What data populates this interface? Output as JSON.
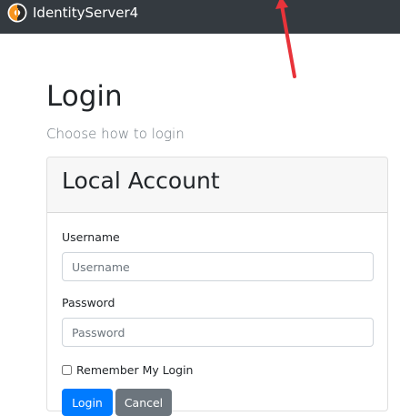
{
  "navbar": {
    "brand": "IdentityServer4",
    "logo_icon": "identityserver-logo-icon"
  },
  "page": {
    "title": "Login",
    "subtitle": "Choose how to login"
  },
  "local_account": {
    "title": "Local Account",
    "username_label": "Username",
    "username_placeholder": "Username",
    "username_value": "",
    "password_label": "Password",
    "password_placeholder": "Password",
    "password_value": "",
    "remember_label": "Remember My Login",
    "remember_checked": false,
    "login_button": "Login",
    "cancel_button": "Cancel"
  },
  "colors": {
    "navbar_bg": "#343a40",
    "primary": "#007bff",
    "secondary": "#6c757d",
    "annotation_arrow": "#e8333a"
  }
}
